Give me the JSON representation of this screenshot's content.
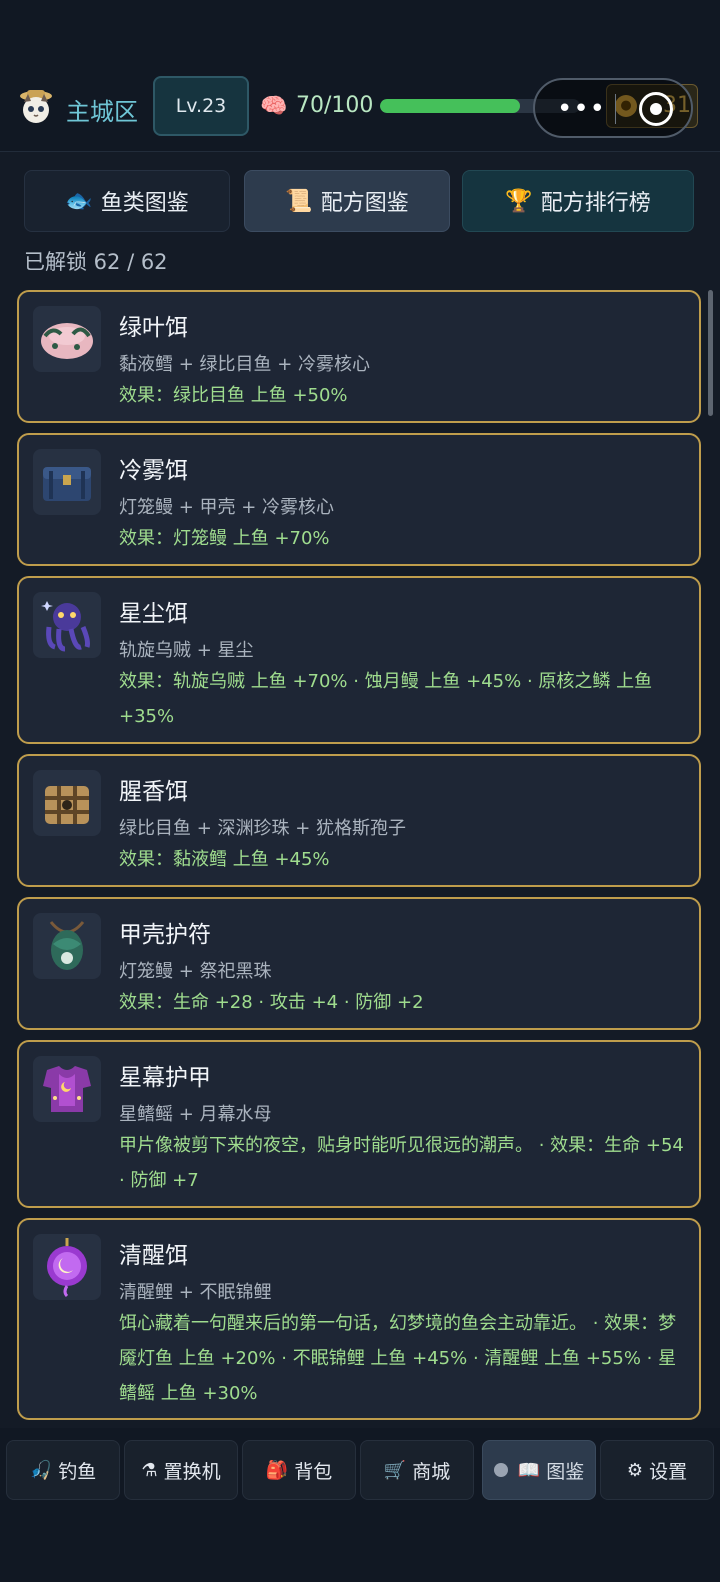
{
  "header": {
    "region": "主城区",
    "level": "Lv.23",
    "energy_text": "70/100",
    "energy_fraction": 0.7,
    "coins_text": "31"
  },
  "tabs": [
    {
      "label": "鱼类图鉴",
      "icon": "fish-icon"
    },
    {
      "label": "配方图鉴",
      "icon": "scroll-icon"
    },
    {
      "label": "配方排行榜",
      "icon": "trophy-icon"
    }
  ],
  "unlock_text": "已解锁 62 / 62",
  "recipes": [
    {
      "name": "绿叶饵",
      "ingredients": "黏液鳕 + 绿比目鱼 + 冷雾核心",
      "effect": "效果：绿比目鱼 上鱼 +50%",
      "icon": "leaf-bait-icon"
    },
    {
      "name": "冷雾饵",
      "ingredients": "灯笼鳗 + 甲壳 + 冷雾核心",
      "effect": "效果：灯笼鳗 上鱼 +70%",
      "icon": "chest-icon"
    },
    {
      "name": "星尘饵",
      "ingredients": "轨旋乌贼 + 星尘",
      "effect": "效果：轨旋乌贼 上鱼 +70% · 蚀月鳗 上鱼 +45% · 原核之鳞 上鱼 +35%",
      "icon": "stardust-squid-icon"
    },
    {
      "name": "腥香饵",
      "ingredients": "绿比目鱼 + 深渊珍珠 + 犹格斯孢子",
      "effect": "效果：黏液鳕 上鱼 +45%",
      "icon": "crate-icon"
    },
    {
      "name": "甲壳护符",
      "ingredients": "灯笼鳗 + 祭祀黑珠",
      "effect": "效果：生命 +28 · 攻击 +4 · 防御 +2",
      "icon": "amulet-icon"
    },
    {
      "name": "星幕护甲",
      "ingredients": "星鳍鳐 + 月幕水母",
      "effect": "甲片像被剪下来的夜空，贴身时能听见很远的潮声。 · 效果：生命 +54 · 防御 +7",
      "icon": "armor-icon"
    },
    {
      "name": "清醒饵",
      "ingredients": "清醒鲤 + 不眠锦鲤",
      "effect": "饵心藏着一句醒来后的第一句话，幻梦境的鱼会主动靠近。 · 效果：梦魇灯鱼 上鱼 +20% · 不眠锦鲤 上鱼 +45% · 清醒鲤 上鱼 +55% · 星鳍鳐 上鱼 +30%",
      "icon": "lantern-orb-icon"
    }
  ],
  "nav": [
    {
      "label": "钓鱼",
      "icon": "fishing-icon"
    },
    {
      "label": "置换机",
      "icon": "machine-icon"
    },
    {
      "label": "背包",
      "icon": "backpack-icon"
    },
    {
      "label": "商城",
      "icon": "cart-icon"
    },
    {
      "label": "图鉴",
      "icon": "book-icon",
      "active": true
    },
    {
      "label": "设置",
      "icon": "gear-icon"
    }
  ]
}
